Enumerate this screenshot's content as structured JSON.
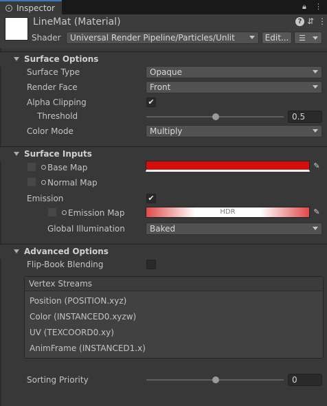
{
  "tab": {
    "label": "Inspector",
    "lock_icon": "lock-icon",
    "menu_icon": "kebab-menu-icon"
  },
  "header": {
    "title": "LineMat (Material)",
    "shader_label": "Shader",
    "shader_value": "Universal Render Pipeline/Particles/Unlit",
    "edit_label": "Edit...",
    "help_icon": "help-icon",
    "settings_icon": "settings-sliders-icon",
    "overflow_icon": "kebab-menu-icon",
    "list_icon": "list-icon"
  },
  "surface_options": {
    "title": "Surface Options",
    "surface_type": {
      "label": "Surface Type",
      "value": "Opaque"
    },
    "render_face": {
      "label": "Render Face",
      "value": "Front"
    },
    "alpha_clipping": {
      "label": "Alpha Clipping",
      "checked": true,
      "check": "✔"
    },
    "threshold": {
      "label": "Threshold",
      "value": "0.5",
      "level": 0.5
    },
    "color_mode": {
      "label": "Color Mode",
      "value": "Multiply"
    }
  },
  "surface_inputs": {
    "title": "Surface Inputs",
    "base_map": {
      "label": "Base Map",
      "color": "#d50d0d"
    },
    "normal_map": {
      "label": "Normal Map"
    },
    "emission": {
      "label": "Emission",
      "checked": true,
      "check": "✔"
    },
    "emission_map": {
      "label": "Emission Map",
      "badge": "HDR",
      "color": "#e04a4a"
    },
    "global_illumination": {
      "label": "Global Illumination",
      "value": "Baked"
    }
  },
  "advanced_options": {
    "title": "Advanced Options",
    "flip_book": {
      "label": "Flip-Book Blending",
      "checked": false
    },
    "vertex_streams": {
      "title": "Vertex Streams",
      "items": [
        "Position (POSITION.xyz)",
        "Color (INSTANCED0.xyzw)",
        "UV (TEXCOORD0.xy)",
        "AnimFrame (INSTANCED1.x)"
      ]
    },
    "sorting_priority": {
      "label": "Sorting Priority",
      "value": "0",
      "level": 0.5
    }
  },
  "colors": {
    "accent": "#3a79bb",
    "background": "#383838"
  }
}
